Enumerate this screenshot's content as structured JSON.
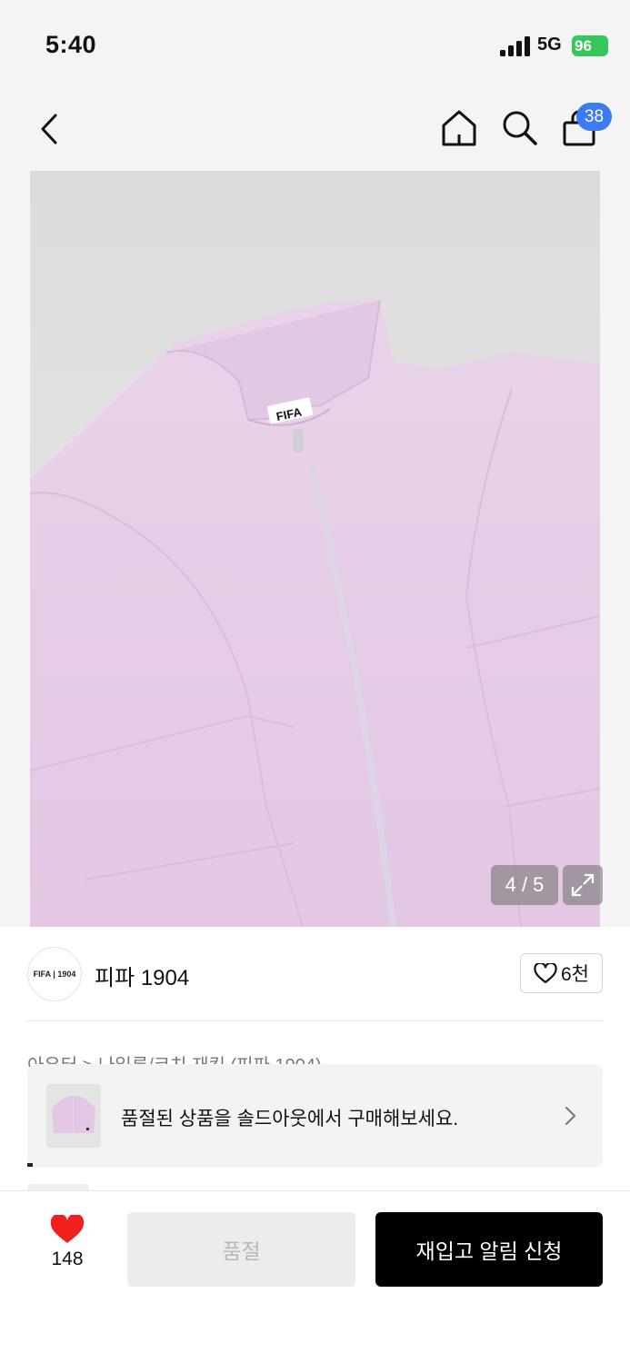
{
  "status_bar": {
    "time": "5:40",
    "network": "5G",
    "battery": "96"
  },
  "header": {
    "cart_count": "38"
  },
  "image": {
    "counter": "4 / 5",
    "alt": "jacket-photo",
    "logo_text": "FIFA"
  },
  "brand": {
    "logo_text": "FIFA | 1904",
    "name": "피파 1904",
    "likes": "6천"
  },
  "breadcrumb": "아우터 > 나일론/코치 재킷 (피파 1904)",
  "soldout_banner": {
    "text": "품절된 상품을 솔드아웃에서 구매해보세요."
  },
  "bottom_bar": {
    "wish_count": "148",
    "soldout_label": "품절",
    "restock_label": "재입고 알림 신청"
  },
  "colors": {
    "accent_badge": "#3d7bf2",
    "heart": "#f0201d",
    "battery": "#34c759",
    "jacket": "#e6cde8"
  },
  "icons": [
    "back-icon",
    "home-icon",
    "search-icon",
    "bag-icon",
    "expand-icon",
    "heart-outline-icon",
    "chevron-right-icon",
    "heart-filled-icon"
  ]
}
